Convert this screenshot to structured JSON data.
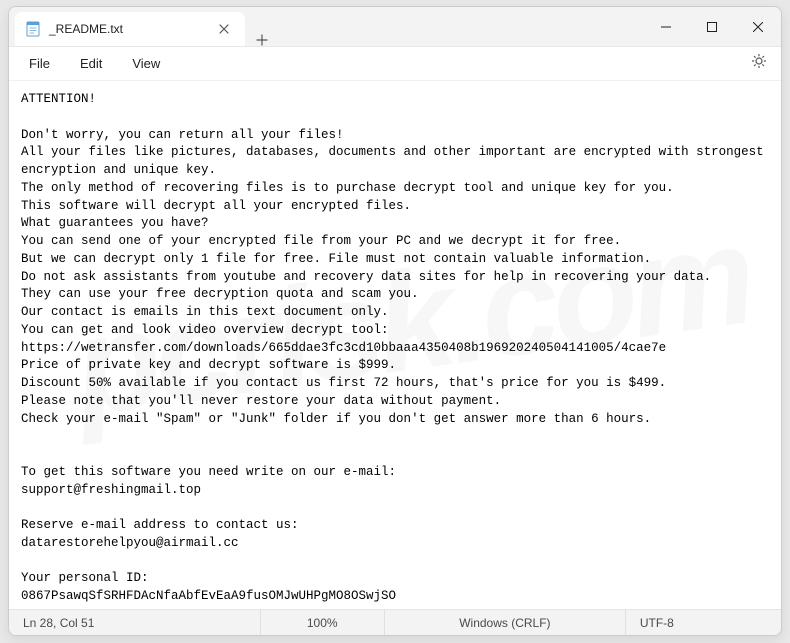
{
  "tab": {
    "title": "_README.txt"
  },
  "menu": {
    "file": "File",
    "edit": "Edit",
    "view": "View"
  },
  "content": "ATTENTION!\n\nDon't worry, you can return all your files!\nAll your files like pictures, databases, documents and other important are encrypted with strongest encryption and unique key.\nThe only method of recovering files is to purchase decrypt tool and unique key for you.\nThis software will decrypt all your encrypted files.\nWhat guarantees you have?\nYou can send one of your encrypted file from your PC and we decrypt it for free.\nBut we can decrypt only 1 file for free. File must not contain valuable information.\nDo not ask assistants from youtube and recovery data sites for help in recovering your data.\nThey can use your free decryption quota and scam you.\nOur contact is emails in this text document only.\nYou can get and look video overview decrypt tool:\nhttps://wetransfer.com/downloads/665ddae3fc3cd10bbaaa4350408b196920240504141005/4cae7e\nPrice of private key and decrypt software is $999.\nDiscount 50% available if you contact us first 72 hours, that's price for you is $499.\nPlease note that you'll never restore your data without payment.\nCheck your e-mail \"Spam\" or \"Junk\" folder if you don't get answer more than 6 hours.\n\n\nTo get this software you need write on our e-mail:\nsupport@freshingmail.top\n\nReserve e-mail address to contact us:\ndatarestorehelpyou@airmail.cc\n\nYour personal ID:\n0867PsawqSfSRHFDAcNfaAbfEvEaA9fusOMJwUHPgMO8OSwjSO",
  "status": {
    "pos": "Ln 28, Col 51",
    "zoom": "100%",
    "line_ending": "Windows (CRLF)",
    "encoding": "UTF-8"
  }
}
